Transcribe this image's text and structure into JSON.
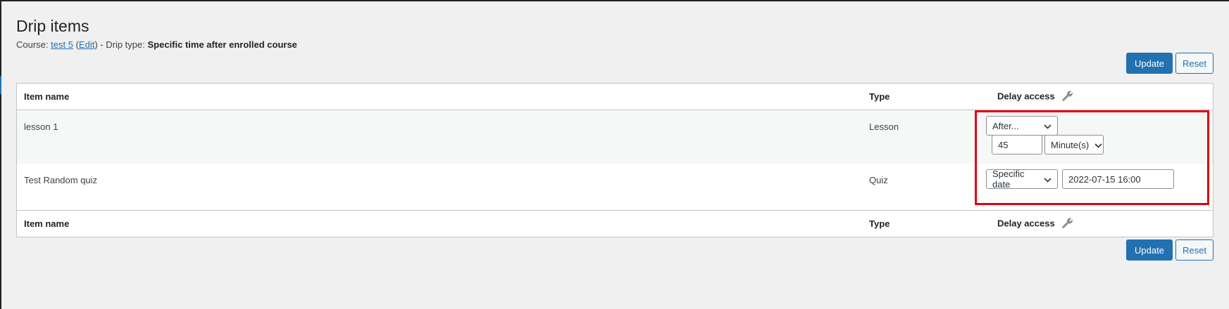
{
  "page": {
    "title": "Drip items",
    "course_label": "Course:",
    "course_name": "test 5",
    "edit_link": "Edit",
    "drip_type_label": "- Drip type:",
    "drip_type_value": "Specific time after enrolled course"
  },
  "buttons": {
    "update": "Update",
    "reset": "Reset"
  },
  "table": {
    "headers": {
      "item_name": "Item name",
      "type": "Type",
      "delay_access": "Delay access"
    },
    "rows": [
      {
        "name": "lesson 1",
        "type": "Lesson",
        "delay_mode": "After...",
        "delay_amount": "45",
        "delay_unit": "Minute(s)"
      },
      {
        "name": "Test Random quiz",
        "type": "Quiz",
        "delay_mode": "Specific date",
        "delay_date": "2022-07-15 16:00"
      }
    ]
  },
  "icons": {
    "wrench": "wrench-icon",
    "chevron": "chevron-down-icon"
  },
  "colors": {
    "accent": "#2271b1",
    "highlight": "#e3000f",
    "background": "#f0f0f1"
  }
}
